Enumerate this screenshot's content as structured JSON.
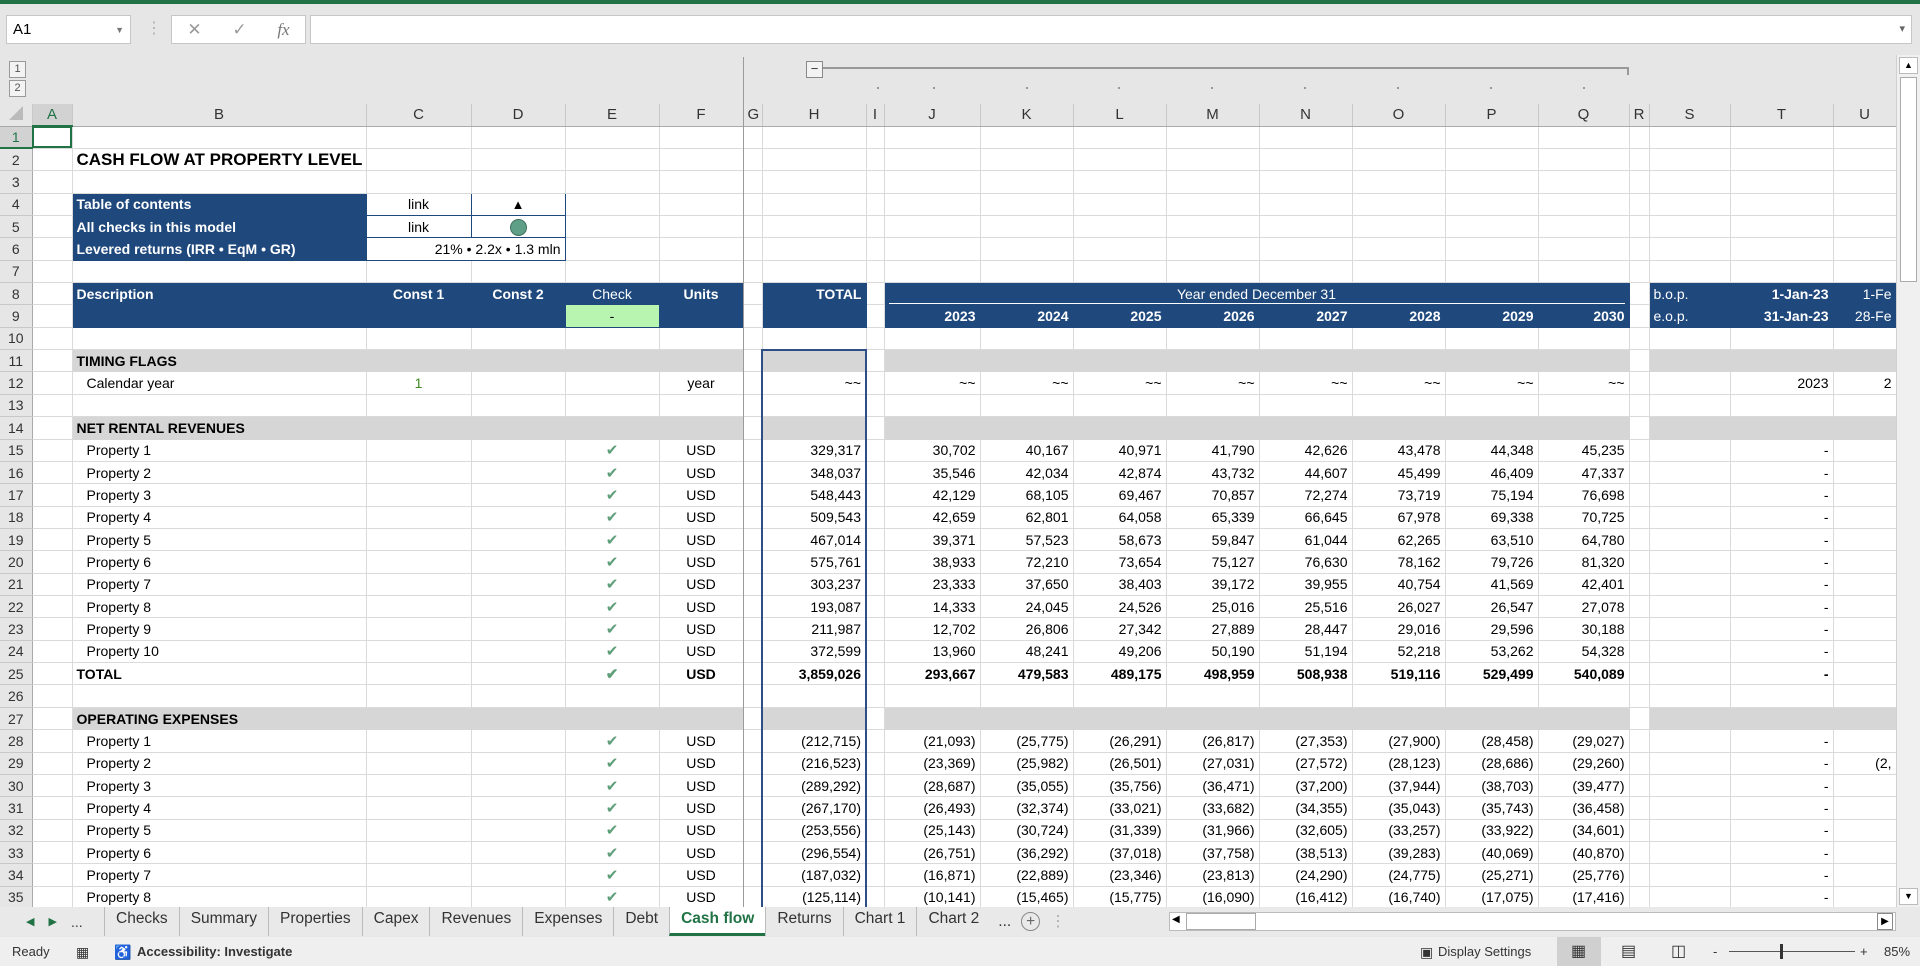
{
  "formula_bar": {
    "name_box": "A1",
    "cancel_icon": "✕",
    "enter_icon": "✓",
    "fx_label": "fx",
    "formula": ""
  },
  "outline": {
    "levels": [
      "1",
      "2"
    ],
    "collapse_label": "−"
  },
  "columns": [
    "A",
    "B",
    "C",
    "D",
    "E",
    "F",
    "G",
    "H",
    "I",
    "J",
    "K",
    "L",
    "M",
    "N",
    "O",
    "P",
    "Q",
    "R",
    "S",
    "T",
    "U"
  ],
  "rows": [
    {
      "num": "1",
      "kind": "blank",
      "cells": {}
    },
    {
      "num": "2",
      "kind": "title",
      "cells": {
        "B": "CASH FLOW AT PROPERTY LEVEL"
      }
    },
    {
      "num": "3",
      "kind": "blank",
      "cells": {}
    },
    {
      "num": "4",
      "kind": "toc",
      "cells": {
        "B": "Table of contents",
        "C": "link"
      },
      "icons": {
        "D": "triangle-up-icon"
      }
    },
    {
      "num": "5",
      "kind": "toc",
      "cells": {
        "B": "All checks in this model",
        "C": "link"
      },
      "icons": {
        "D": "status-circle-icon"
      }
    },
    {
      "num": "6",
      "kind": "toc",
      "cells": {
        "B": "Levered returns (IRR • EqM • GR)",
        "C": "21% • 2.2x • 1.3 mln"
      },
      "merge": {
        "C": 2
      }
    },
    {
      "num": "7",
      "kind": "blank",
      "cells": {}
    },
    {
      "num": "8",
      "kind": "hdr",
      "cells": {
        "B": "Description",
        "C": "Const 1",
        "D": "Const 2",
        "E": "Check",
        "F": "Units",
        "H": "TOTAL",
        "J": "Year ended December 31",
        "S": "b.o.p.",
        "T": "1-Jan-23",
        "U": "1-Fe"
      },
      "merge": {
        "J": 8
      }
    },
    {
      "num": "9",
      "kind": "hdr",
      "cells": {
        "E": "-",
        "S": "e.o.p.",
        "T": "31-Jan-23",
        "U": "28-Fe"
      },
      "values": [
        "2023",
        "2024",
        "2025",
        "2026",
        "2027",
        "2028",
        "2029",
        "2030"
      ]
    },
    {
      "num": "10",
      "kind": "blank",
      "cells": {}
    },
    {
      "num": "11",
      "kind": "section",
      "cells": {
        "B": "TIMING FLAGS"
      }
    },
    {
      "num": "12",
      "kind": "item",
      "cells": {
        "B": "Calendar year",
        "C": "1",
        "F": "year",
        "H": "~~",
        "T": "2023",
        "U": "2"
      },
      "values": [
        "~~",
        "~~",
        "~~",
        "~~",
        "~~",
        "~~",
        "~~",
        "~~"
      ]
    },
    {
      "num": "13",
      "kind": "blank",
      "cells": {}
    },
    {
      "num": "14",
      "kind": "section",
      "cells": {
        "B": "NET RENTAL REVENUES"
      }
    },
    {
      "num": "15",
      "kind": "item",
      "check": true,
      "cells": {
        "B": "Property 1",
        "F": "USD",
        "H": "329,317",
        "T": "-"
      },
      "values": [
        "30,702",
        "40,167",
        "40,971",
        "41,790",
        "42,626",
        "43,478",
        "44,348",
        "45,235"
      ]
    },
    {
      "num": "16",
      "kind": "item",
      "check": true,
      "cells": {
        "B": "Property 2",
        "F": "USD",
        "H": "348,037",
        "T": "-"
      },
      "values": [
        "35,546",
        "42,034",
        "42,874",
        "43,732",
        "44,607",
        "45,499",
        "46,409",
        "47,337"
      ]
    },
    {
      "num": "17",
      "kind": "item",
      "check": true,
      "cells": {
        "B": "Property 3",
        "F": "USD",
        "H": "548,443",
        "T": "-"
      },
      "values": [
        "42,129",
        "68,105",
        "69,467",
        "70,857",
        "72,274",
        "73,719",
        "75,194",
        "76,698"
      ]
    },
    {
      "num": "18",
      "kind": "item",
      "check": true,
      "cells": {
        "B": "Property 4",
        "F": "USD",
        "H": "509,543",
        "T": "-"
      },
      "values": [
        "42,659",
        "62,801",
        "64,058",
        "65,339",
        "66,645",
        "67,978",
        "69,338",
        "70,725"
      ]
    },
    {
      "num": "19",
      "kind": "item",
      "check": true,
      "cells": {
        "B": "Property 5",
        "F": "USD",
        "H": "467,014",
        "T": "-"
      },
      "values": [
        "39,371",
        "57,523",
        "58,673",
        "59,847",
        "61,044",
        "62,265",
        "63,510",
        "64,780"
      ]
    },
    {
      "num": "20",
      "kind": "item",
      "check": true,
      "cells": {
        "B": "Property 6",
        "F": "USD",
        "H": "575,761",
        "T": "-"
      },
      "values": [
        "38,933",
        "72,210",
        "73,654",
        "75,127",
        "76,630",
        "78,162",
        "79,726",
        "81,320"
      ]
    },
    {
      "num": "21",
      "kind": "item",
      "check": true,
      "cells": {
        "B": "Property 7",
        "F": "USD",
        "H": "303,237",
        "T": "-"
      },
      "values": [
        "23,333",
        "37,650",
        "38,403",
        "39,172",
        "39,955",
        "40,754",
        "41,569",
        "42,401"
      ]
    },
    {
      "num": "22",
      "kind": "item",
      "check": true,
      "cells": {
        "B": "Property 8",
        "F": "USD",
        "H": "193,087",
        "T": "-"
      },
      "values": [
        "14,333",
        "24,045",
        "24,526",
        "25,016",
        "25,516",
        "26,027",
        "26,547",
        "27,078"
      ]
    },
    {
      "num": "23",
      "kind": "item",
      "check": true,
      "cells": {
        "B": "Property 9",
        "F": "USD",
        "H": "211,987",
        "T": "-"
      },
      "values": [
        "12,702",
        "26,806",
        "27,342",
        "27,889",
        "28,447",
        "29,016",
        "29,596",
        "30,188"
      ]
    },
    {
      "num": "24",
      "kind": "item",
      "check": true,
      "cells": {
        "B": "Property 10",
        "F": "USD",
        "H": "372,599",
        "T": "-"
      },
      "values": [
        "13,960",
        "48,241",
        "49,206",
        "50,190",
        "51,194",
        "52,218",
        "53,262",
        "54,328"
      ]
    },
    {
      "num": "25",
      "kind": "total",
      "check": true,
      "cells": {
        "B": "TOTAL",
        "F": "USD",
        "H": "3,859,026",
        "T": "-"
      },
      "values": [
        "293,667",
        "479,583",
        "489,175",
        "498,959",
        "508,938",
        "519,116",
        "529,499",
        "540,089"
      ]
    },
    {
      "num": "26",
      "kind": "blank",
      "cells": {}
    },
    {
      "num": "27",
      "kind": "section",
      "cells": {
        "B": "OPERATING EXPENSES"
      }
    },
    {
      "num": "28",
      "kind": "item",
      "check": true,
      "cells": {
        "B": "Property 1",
        "F": "USD",
        "H": "(212,715)",
        "T": "-"
      },
      "values": [
        "(21,093)",
        "(25,775)",
        "(26,291)",
        "(26,817)",
        "(27,353)",
        "(27,900)",
        "(28,458)",
        "(29,027)"
      ]
    },
    {
      "num": "29",
      "kind": "item",
      "check": true,
      "cells": {
        "B": "Property 2",
        "F": "USD",
        "H": "(216,523)",
        "T": "-",
        "U": "(2,"
      },
      "values": [
        "(23,369)",
        "(25,982)",
        "(26,501)",
        "(27,031)",
        "(27,572)",
        "(28,123)",
        "(28,686)",
        "(29,260)"
      ]
    },
    {
      "num": "30",
      "kind": "item",
      "check": true,
      "cells": {
        "B": "Property 3",
        "F": "USD",
        "H": "(289,292)",
        "T": "-"
      },
      "values": [
        "(28,687)",
        "(35,055)",
        "(35,756)",
        "(36,471)",
        "(37,200)",
        "(37,944)",
        "(38,703)",
        "(39,477)"
      ]
    },
    {
      "num": "31",
      "kind": "item",
      "check": true,
      "cells": {
        "B": "Property 4",
        "F": "USD",
        "H": "(267,170)",
        "T": "-"
      },
      "values": [
        "(26,493)",
        "(32,374)",
        "(33,021)",
        "(33,682)",
        "(34,355)",
        "(35,043)",
        "(35,743)",
        "(36,458)"
      ]
    },
    {
      "num": "32",
      "kind": "item",
      "check": true,
      "cells": {
        "B": "Property 5",
        "F": "USD",
        "H": "(253,556)",
        "T": "-"
      },
      "values": [
        "(25,143)",
        "(30,724)",
        "(31,339)",
        "(31,966)",
        "(32,605)",
        "(33,257)",
        "(33,922)",
        "(34,601)"
      ]
    },
    {
      "num": "33",
      "kind": "item",
      "check": true,
      "cells": {
        "B": "Property 6",
        "F": "USD",
        "H": "(296,554)",
        "T": "-"
      },
      "values": [
        "(26,751)",
        "(36,292)",
        "(37,018)",
        "(37,758)",
        "(38,513)",
        "(39,283)",
        "(40,069)",
        "(40,870)"
      ]
    },
    {
      "num": "34",
      "kind": "item",
      "check": true,
      "cells": {
        "B": "Property 7",
        "F": "USD",
        "H": "(187,032)",
        "T": "-"
      },
      "values": [
        "(16,871)",
        "(22,889)",
        "(23,346)",
        "(23,813)",
        "(24,290)",
        "(24,775)",
        "(25,271)",
        "(25,776)"
      ]
    },
    {
      "num": "35",
      "kind": "item",
      "check": true,
      "cells": {
        "B": "Property 8",
        "F": "USD",
        "H": "(125,114)",
        "T": "-"
      },
      "values": [
        "(10,141)",
        "(15,465)",
        "(15,775)",
        "(16,090)",
        "(16,412)",
        "(16,740)",
        "(17,075)",
        "(17,416)"
      ]
    }
  ],
  "sheet_tabs": {
    "more_left": "...",
    "tabs": [
      "Checks",
      "Summary",
      "Properties",
      "Capex",
      "Revenues",
      "Expenses",
      "Debt",
      "Cash flow",
      "Returns",
      "Chart 1",
      "Chart 2"
    ],
    "active": "Cash flow",
    "more_right": "...",
    "add_label": "+"
  },
  "status_bar": {
    "ready": "Ready",
    "accessibility": "Accessibility: Investigate",
    "display_settings": "Display Settings",
    "zoom": "85%",
    "zoom_minus": "-",
    "zoom_plus": "+",
    "zoom_percent": 85
  },
  "colors": {
    "header_blue": "#1f497d",
    "section_gray": "#d6d6d6",
    "check_green": "#5e9e78",
    "check_cell_green": "#b8f5b0",
    "excel_green": "#217346"
  }
}
